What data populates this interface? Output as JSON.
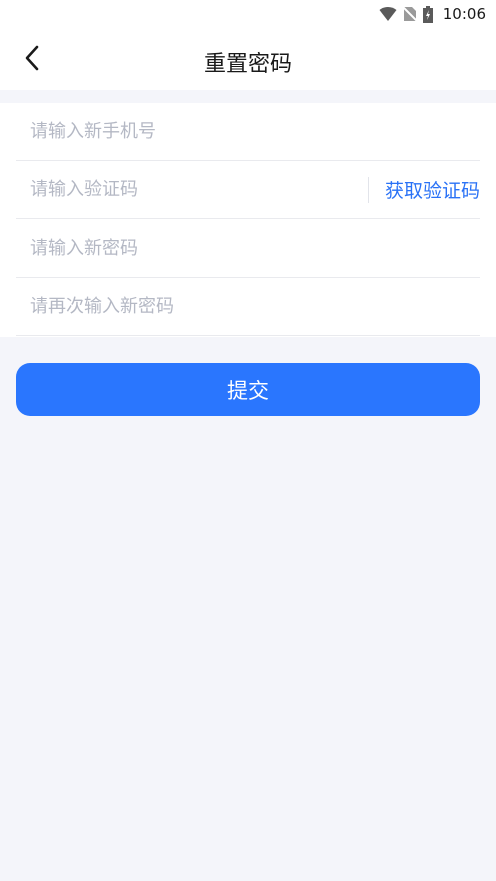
{
  "status_bar": {
    "time": "10:06",
    "icons": [
      "wifi-icon",
      "no-sim-icon",
      "battery-charging-icon"
    ]
  },
  "header": {
    "title": "重置密码",
    "back_icon": "chevron-left-icon"
  },
  "form": {
    "phone_placeholder": "请输入新手机号",
    "code_placeholder": "请输入验证码",
    "get_code_label": "获取验证码",
    "password_placeholder": "请输入新密码",
    "confirm_password_placeholder": "请再次输入新密码"
  },
  "submit_label": "提交",
  "colors": {
    "accent": "#2a76fe",
    "background": "#f4f5fa",
    "placeholder": "#b4b8c4"
  }
}
